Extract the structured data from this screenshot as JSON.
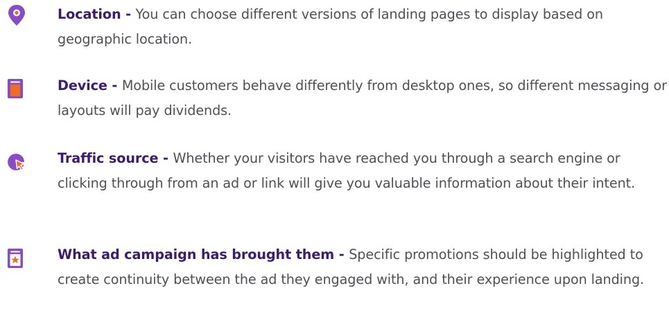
{
  "colors": {
    "title": "#3d1b6e",
    "body": "#4f4f58",
    "purple": "#8a4bc7",
    "orange": "#f26b21"
  },
  "items": [
    {
      "icon": "location-pin-icon",
      "title": "Location - ",
      "text": "You can choose different versions of landing pages to display based on geographic location."
    },
    {
      "icon": "mobile-device-icon",
      "title": "Device - ",
      "text": "Mobile customers behave differently from desktop ones, so different messaging or layouts will pay dividends."
    },
    {
      "icon": "traffic-source-cursor-icon",
      "title": "Traffic source - ",
      "text": "Whether your visitors have reached you through a search engine or clicking through from an ad or link will give you valuable information about their intent."
    },
    {
      "icon": "ad-campaign-star-icon",
      "title": "What ad campaign has brought them - ",
      "text": "Specific promotions should be highlighted to create continuity between the ad they engaged with, and their experience upon landing."
    }
  ]
}
